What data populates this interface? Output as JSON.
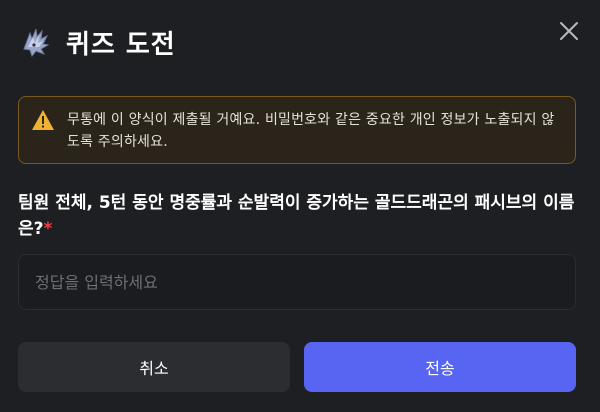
{
  "dialog": {
    "title": "퀴즈 도전",
    "close_icon": "close-icon",
    "logo_icon": "quiz-logo-icon"
  },
  "warning": {
    "icon": "warning-icon",
    "text": "무통에 이 양식이 제출될 거예요. 비밀번호와 같은 중요한 개인 정보가 노출되지 않도록 주의하세요.",
    "border_color": "#7a5a1e",
    "icon_color": "#f0b232"
  },
  "question": {
    "text": "팀원 전체, 5턴 동안 명중률과 순발력이 증가하는 골드드래곤의 패시브의 이름은?",
    "required_mark": "*"
  },
  "answer": {
    "value": "",
    "placeholder": "정답을 입력하세요"
  },
  "buttons": {
    "cancel_label": "취소",
    "submit_label": "전송",
    "submit_color": "#5865f2"
  }
}
